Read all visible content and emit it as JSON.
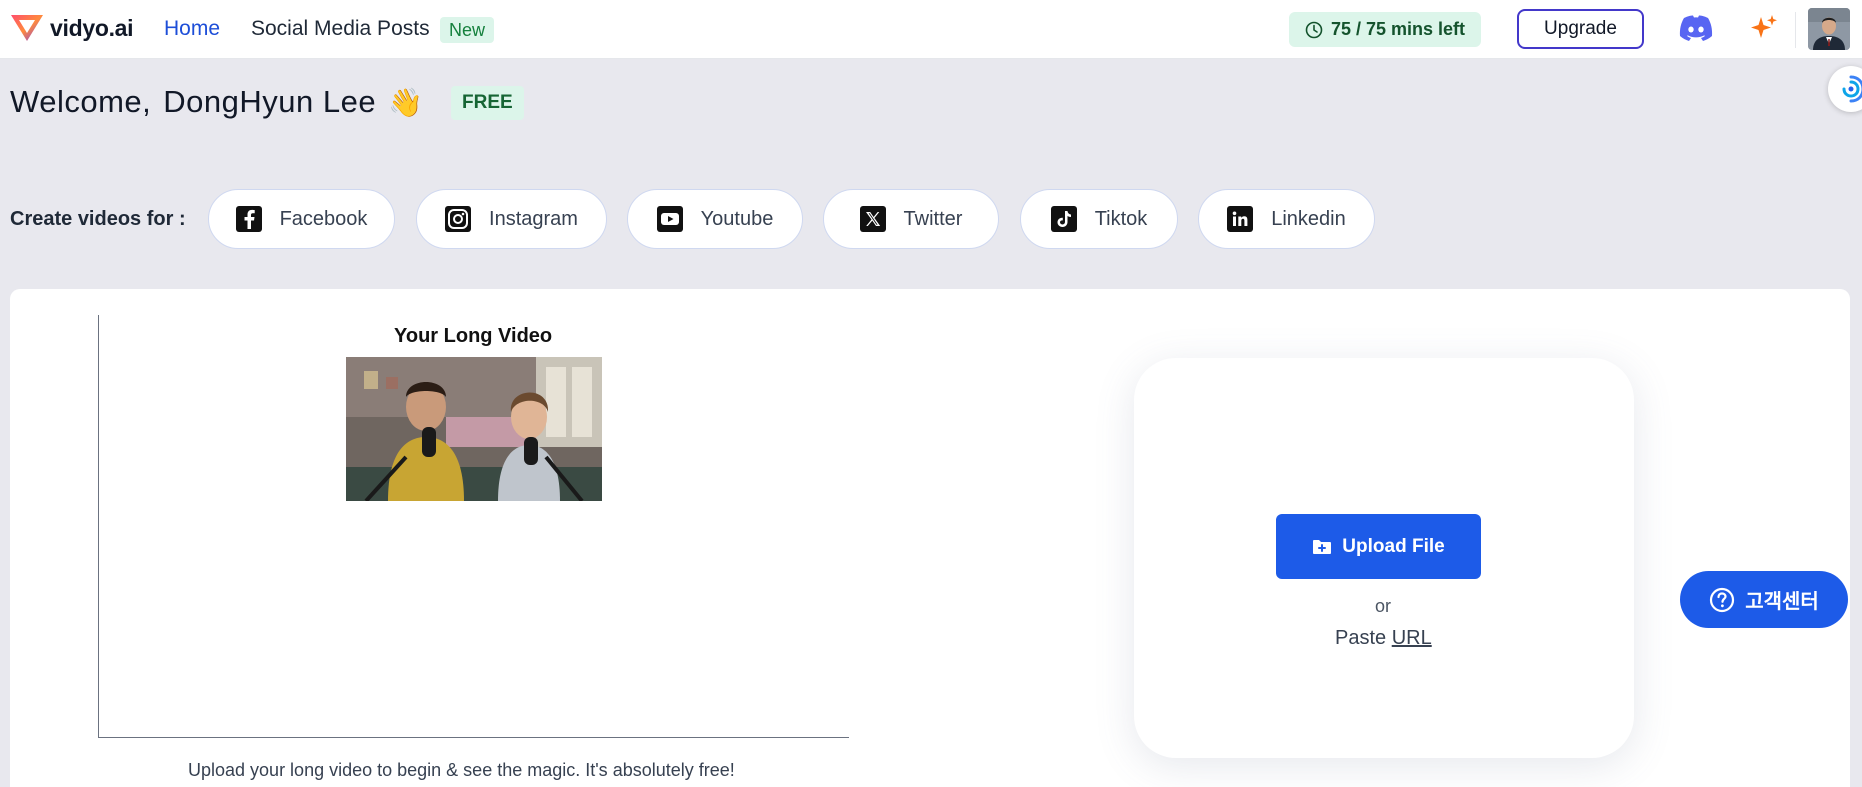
{
  "header": {
    "logo_text": "vidyo.ai",
    "nav": {
      "home": "Home",
      "social": "Social Media Posts",
      "new_badge": "New"
    },
    "minutes": "75 / 75 mins left",
    "upgrade": "Upgrade",
    "icons": [
      "clock-icon",
      "discord-icon",
      "sparkle-icon",
      "user-avatar"
    ]
  },
  "welcome": {
    "prefix": "Welcome,",
    "name": "DongHyun Lee",
    "wave": "👋",
    "plan": "FREE"
  },
  "platforms": {
    "label": "Create videos for :",
    "items": [
      {
        "label": "Facebook",
        "icon": "facebook-icon"
      },
      {
        "label": "Instagram",
        "icon": "instagram-icon"
      },
      {
        "label": "Youtube",
        "icon": "youtube-icon"
      },
      {
        "label": "Twitter",
        "icon": "x-twitter-icon"
      },
      {
        "label": "Tiktok",
        "icon": "tiktok-icon"
      },
      {
        "label": "Linkedin",
        "icon": "linkedin-icon"
      }
    ]
  },
  "preview": {
    "title": "Your Long Video",
    "caption": "Upload your long video to begin & see the magic. It's absolutely free!"
  },
  "upload": {
    "button": "Upload File",
    "or": "or",
    "paste": "Paste",
    "url": "URL"
  },
  "help": {
    "label": "고객센터"
  },
  "colors": {
    "accent": "#1d5be8",
    "brand_link": "#1d4ed8",
    "success_bg": "#dcf5ea",
    "page_bg": "#e8e8ee"
  }
}
